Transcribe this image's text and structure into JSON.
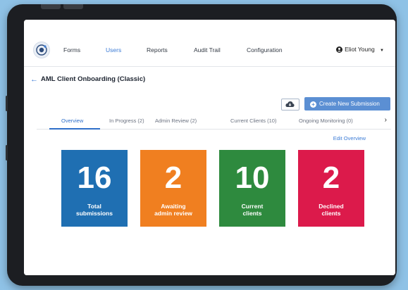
{
  "nav": {
    "items": [
      "Forms",
      "Users",
      "Reports",
      "Audit Trail",
      "Configuration"
    ],
    "active": "Users"
  },
  "user": {
    "name": "Eliot Young"
  },
  "page": {
    "title": "AML Client Onboarding (Classic)"
  },
  "toolbar": {
    "create_label": "Create New Submission"
  },
  "tabs": [
    "Overview",
    "In Progress (2)",
    "Admin Review (2)",
    "Current Clients (10)",
    "Ongoing Monitoring (0)"
  ],
  "edit_overview": "Edit Overview",
  "cards": [
    {
      "value": "16",
      "line1": "Total",
      "line2": "submissions",
      "color": "#1f6fb2"
    },
    {
      "value": "2",
      "line1": "Awaiting",
      "line2": "admin review",
      "color": "#f07f20"
    },
    {
      "value": "10",
      "line1": "Current",
      "line2": "clients",
      "color": "#2e8a3e"
    },
    {
      "value": "2",
      "line1": "Declined",
      "line2": "clients",
      "color": "#dc1a4b"
    }
  ],
  "colors": {
    "accent": "#3b7bd6",
    "button": "#5b8fd3",
    "background": "#8fc2e6"
  }
}
